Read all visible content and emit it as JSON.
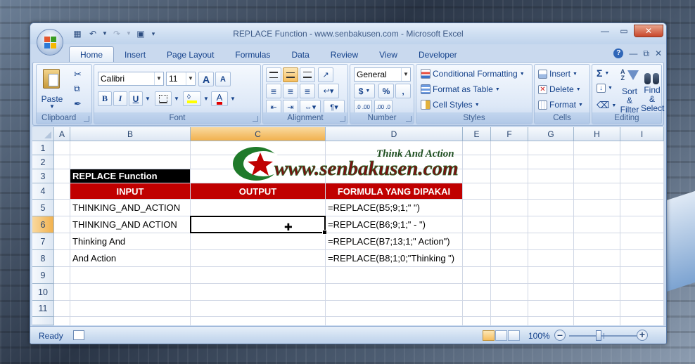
{
  "window": {
    "title": "REPLACE Function - www.senbakusen.com - Microsoft Excel"
  },
  "tabs": [
    {
      "label": "Home",
      "active": true
    },
    {
      "label": "Insert"
    },
    {
      "label": "Page Layout"
    },
    {
      "label": "Formulas"
    },
    {
      "label": "Data"
    },
    {
      "label": "Review"
    },
    {
      "label": "View"
    },
    {
      "label": "Developer"
    }
  ],
  "ribbon": {
    "clipboard": {
      "label": "Clipboard",
      "paste": "Paste"
    },
    "font": {
      "label": "Font",
      "name": "Calibri",
      "size": "11",
      "bold": "B",
      "italic": "I",
      "underline": "U",
      "grow": "A",
      "shrink": "A",
      "color_letter": "A"
    },
    "alignment": {
      "label": "Alignment"
    },
    "number": {
      "label": "Number",
      "format": "General",
      "currency": "$",
      "percent": "%",
      "comma": ",",
      "inc": ".0 .00",
      "dec": ".00 .0"
    },
    "styles": {
      "label": "Styles",
      "conditional": "Conditional Formatting",
      "format_table": "Format as Table",
      "cell_styles": "Cell Styles"
    },
    "cells": {
      "label": "Cells",
      "insert": "Insert",
      "delete": "Delete",
      "format": "Format"
    },
    "editing": {
      "label": "Editing",
      "sigma": "Σ",
      "sort": "Sort &",
      "sort2": "Filter",
      "find": "Find &",
      "find2": "Select"
    }
  },
  "columns": [
    "A",
    "B",
    "C",
    "D",
    "E",
    "F",
    "G",
    "H",
    "I"
  ],
  "rows": [
    "1",
    "2",
    "3",
    "4",
    "5",
    "6",
    "7",
    "8",
    "9",
    "10",
    "11"
  ],
  "cells": {
    "b3": "REPLACE Function",
    "b4": "INPUT",
    "c4": "OUTPUT",
    "d4": "FORMULA YANG DIPAKAI",
    "b5": "THINKING_AND_ACTION",
    "d5": "=REPLACE(B5;9;1;\" \")",
    "b6": "THINKING_AND ACTION",
    "d6": "=REPLACE(B6;9;1;\" - \")",
    "b7": "Thinking And",
    "d7": "=REPLACE(B7;13;1;\" Action\")",
    "b8": "And Action",
    "d8": "=REPLACE(B8;1;0;\"Thinking \")"
  },
  "watermark": {
    "tagline": "Think And Action",
    "site": "www.senbakusen.com"
  },
  "status": {
    "ready": "Ready",
    "zoom": "100%"
  },
  "colors": {
    "header_red": "#c00000",
    "title_black": "#000000",
    "selected_header": "#f6be5f"
  }
}
